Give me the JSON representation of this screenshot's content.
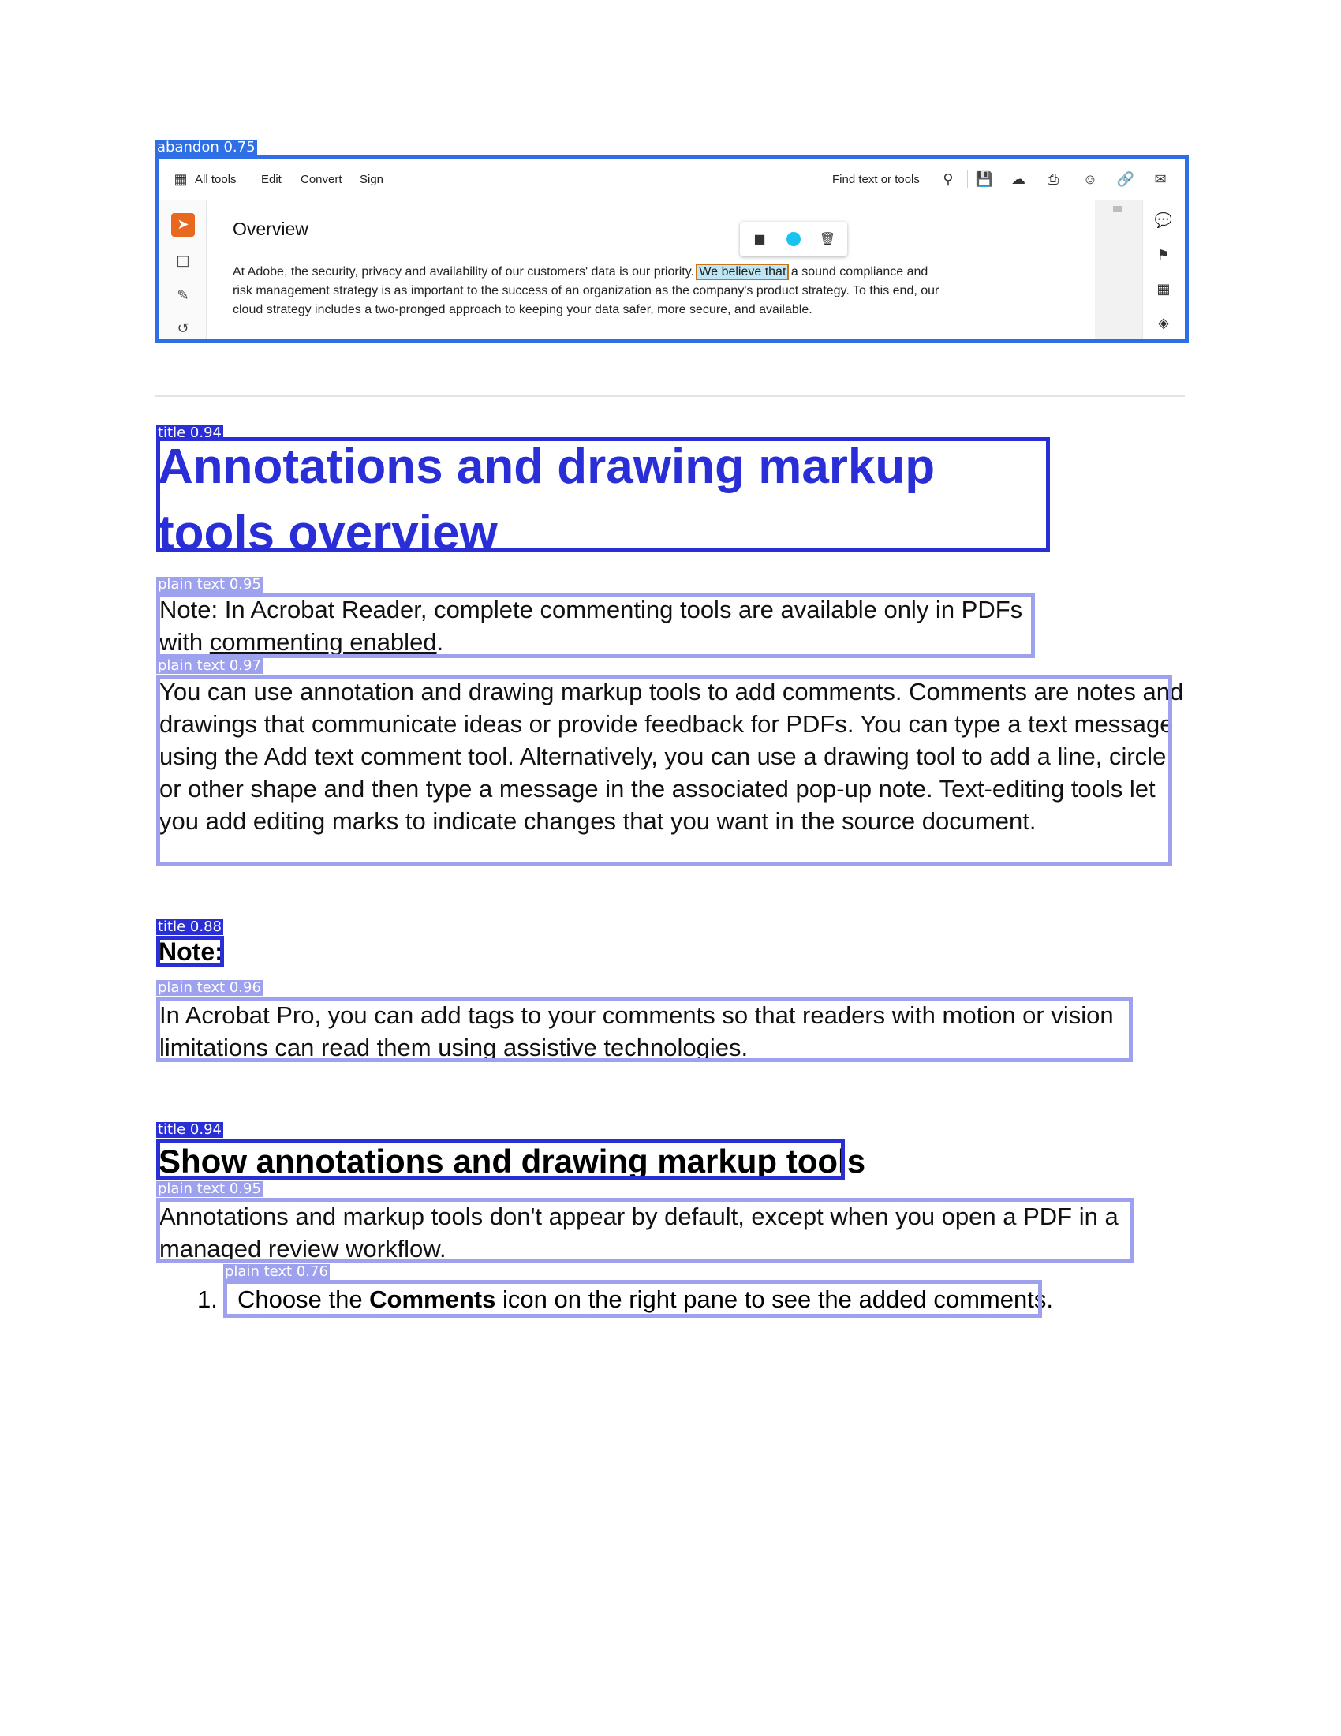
{
  "detections": [
    {
      "label": "abandon 0.75",
      "kind": "abandon"
    },
    {
      "label": "title 0.94",
      "kind": "title"
    },
    {
      "label": "plain text 0.95",
      "kind": "text"
    },
    {
      "label": "plain text 0.97",
      "kind": "text"
    },
    {
      "label": "title 0.88",
      "kind": "title"
    },
    {
      "label": "plain text 0.96",
      "kind": "text"
    },
    {
      "label": "title 0.94",
      "kind": "title"
    },
    {
      "label": "plain text 0.95",
      "kind": "text"
    },
    {
      "label": "plain text 0.76",
      "kind": "text"
    }
  ],
  "screenshot": {
    "toolbar": {
      "all_tools": "All tools",
      "edit": "Edit",
      "convert": "Convert",
      "sign": "Sign",
      "find": "Find text or tools"
    },
    "heading": "Overview",
    "para": {
      "l1_before": "At Adobe, the security, privacy and availability of our customers' data is our priority.",
      "l1_highlight": "We believe that",
      "l1_after": "a sound compliance and",
      "l2": "risk management strategy is as important to the success of an organization as the company's product strategy. To this end, our",
      "l3": "cloud strategy includes a two-pronged approach to keeping your data safer, more secure, and available."
    }
  },
  "doc": {
    "title": "Annotations and drawing markup tools overview",
    "note_intro": "Note: In Acrobat Reader, complete commenting tools are available only in PDFs with ",
    "note_link": "commenting enabled",
    "note_end": ".",
    "body": "You can use annotation and drawing markup tools to add comments. Comments are notes and drawings that communicate ideas or provide feedback for PDFs. You can type a text message using the Add text comment tool. Alternatively, you can use a drawing tool to add a line, circle, or other shape and then type a message in the associated pop-up note. Text-editing tools let you add editing marks to indicate changes that you want in the source document.",
    "note_heading": "Note:",
    "acrobat_pro": "In Acrobat Pro, you can add tags to your comments so that readers with motion or vision limitations can read them using assistive technologies.",
    "show_heading": "Show annotations and drawing markup tools",
    "show_body": "Annotations and markup tools don't appear by default, except when you open a PDF in a managed review workflow.",
    "step_num": "1.",
    "step_pre": "Choose the ",
    "step_bold": "Comments",
    "step_post": " icon on the right pane to see the added comments."
  }
}
